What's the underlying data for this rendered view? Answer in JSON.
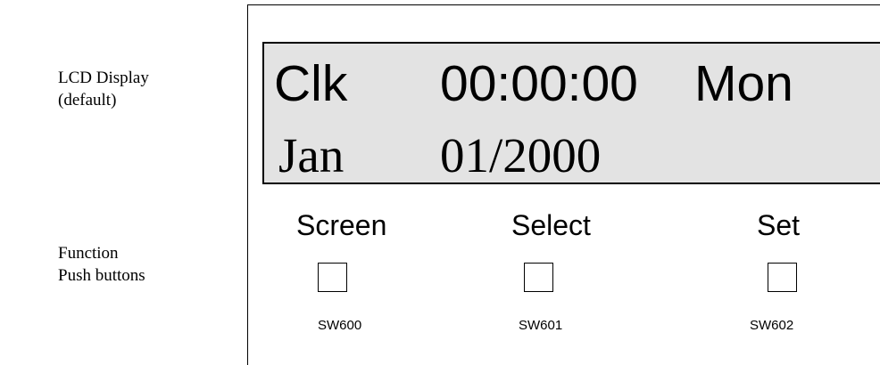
{
  "labels": {
    "lcd_line1": "LCD Display",
    "lcd_line2": "(default)",
    "buttons_line1": "Function",
    "buttons_line2": "Push buttons"
  },
  "lcd": {
    "row1": {
      "mode": "Clk",
      "time": "00:00:00",
      "day": "Mon"
    },
    "row2": {
      "month": "Jan",
      "date": "01/2000"
    },
    "background_color": "#e3e3e3"
  },
  "buttons": [
    {
      "label": "Screen",
      "id": "SW600"
    },
    {
      "label": "Select",
      "id": "SW601"
    },
    {
      "label": "Set",
      "id": "SW602"
    }
  ]
}
